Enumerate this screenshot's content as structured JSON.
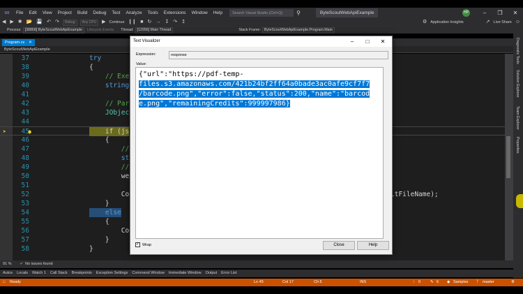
{
  "menu": {
    "items": [
      "File",
      "Edit",
      "View",
      "Project",
      "Build",
      "Debug",
      "Test",
      "Analyze",
      "Tools",
      "Extensions",
      "Window",
      "Help"
    ],
    "search_placeholder": "Search Visual Studio (Ctrl+Q)",
    "solution_name": "ByteScoutWebApiExample",
    "user_initials": "HP"
  },
  "toolbar": {
    "config": "Debug",
    "platform": "Any CPU",
    "continue_label": "Continue",
    "app_insights": "Application Insights",
    "live_share": "Live Share"
  },
  "debug_bar": {
    "process_label": "Process:",
    "process_value": "[38868] ByteScoutWebApiExample",
    "lifecycle_label": "Lifecycle Events",
    "thread_label": "Thread:",
    "thread_value": "[12956] Main Thread",
    "stack_label": "Stack Frame:",
    "stack_value": "ByteScoutWebApiExample.Program.Main"
  },
  "editor": {
    "tab_label": "Program.cs",
    "nav_project": "ByteScoutWebApiExample",
    "lines": [
      {
        "n": "37",
        "code": "try"
      },
      {
        "n": "38",
        "code": "{"
      },
      {
        "n": "39",
        "code": "    // Exe"
      },
      {
        "n": "40",
        "code": "    string"
      },
      {
        "n": "41",
        "code": ""
      },
      {
        "n": "42",
        "code": "    // Par"
      },
      {
        "n": "43",
        "code": "    JObjec"
      },
      {
        "n": "44",
        "code": ""
      },
      {
        "n": "45",
        "code": "    if (js"
      },
      {
        "n": "46",
        "code": "    {"
      },
      {
        "n": "47",
        "code": "        //"
      },
      {
        "n": "48",
        "code": "        st"
      },
      {
        "n": "49",
        "code": "        //"
      },
      {
        "n": "50",
        "code": "        we"
      },
      {
        "n": "51",
        "code": ""
      },
      {
        "n": "52",
        "code": "        Co"
      },
      {
        "n": "53",
        "code": "    }"
      },
      {
        "n": "54",
        "code": "    else"
      },
      {
        "n": "55",
        "code": "    {"
      },
      {
        "n": "56",
        "code": "        Co"
      },
      {
        "n": "57",
        "code": "    }"
      },
      {
        "n": "58",
        "code": "}"
      }
    ],
    "trailing_code": "ltFileName);"
  },
  "status_strip": {
    "zoom": "91 %",
    "issues": "No issues found"
  },
  "bottom_tabs": [
    "Autos",
    "Locals",
    "Watch 1",
    "Call Stack",
    "Breakpoints",
    "Exception Settings",
    "Command Window",
    "Immediate Window",
    "Output",
    "Error List"
  ],
  "statusbar": {
    "ready": "Ready",
    "ln": "Ln 45",
    "col": "Col 17",
    "ch": "Ch 5",
    "ins": "INS",
    "up_count": "0",
    "pencil_count": "6",
    "repo": "Samples",
    "branch": "master"
  },
  "right_rail": [
    "Diagnostic Tools",
    "Solution Explorer",
    "Team Explorer",
    "Properties"
  ],
  "dialog": {
    "title": "Text Visualizer",
    "expression_label": "Expression:",
    "expression_value": "response",
    "value_label": "Value:",
    "value_line1": "{\"url\":\"https://pdf-temp-",
    "value_line2": "files.s3.amazonaws.com/421b24bf2ff64a0bade3ac0afe9cf7f7",
    "value_line3": "/barcode.png\",\"error\":false,\"status\":200,\"name\":\"barcod",
    "value_line4": "e.png\",\"remainingCredits\":999997986}",
    "wrap_label": "Wrap",
    "close_label": "Close",
    "help_label": "Help"
  },
  "colors": {
    "accent": "#007acc",
    "statusbar": "#ca5100",
    "selection": "#0078d7"
  }
}
